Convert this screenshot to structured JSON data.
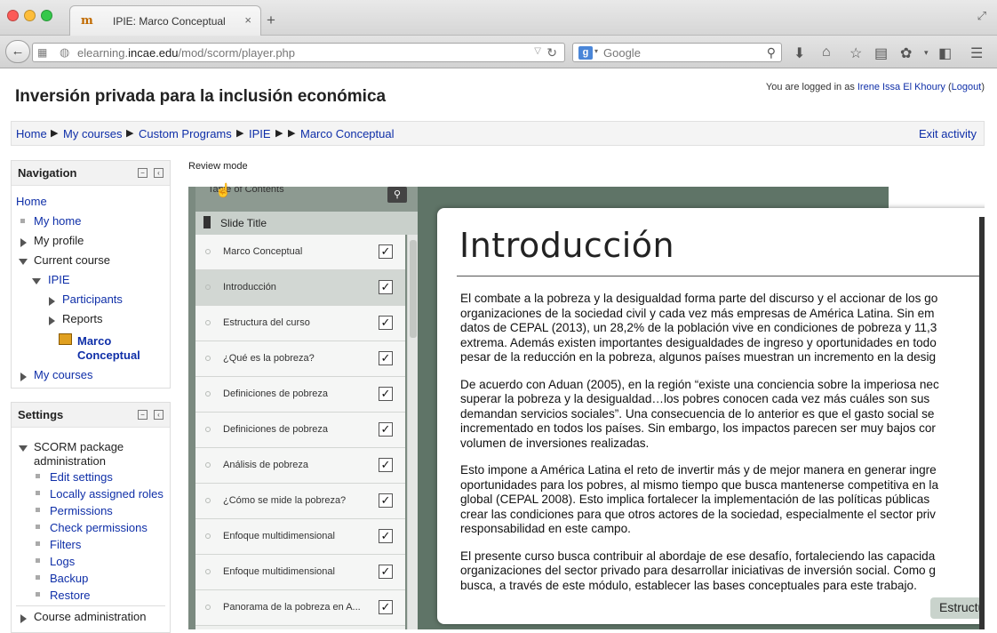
{
  "browser": {
    "tab_title": "IPIE: Marco Conceptual",
    "tab_close": "×",
    "new_tab": "+",
    "url_domain_prefix": "elearning.",
    "url_domain": "incae.edu",
    "url_path": "/mod/scorm/player.php",
    "search_placeholder": "Google"
  },
  "site": {
    "title": "Inversión privada para la inclusión económica",
    "login_prefix": "You are logged in as ",
    "user_name": "Irene Issa El Khoury",
    "logout": "Logout"
  },
  "breadcrumb": {
    "items": [
      "Home",
      "My courses",
      "Custom Programs",
      "IPIE",
      "Marco Conceptual"
    ],
    "exit": "Exit activity"
  },
  "navigation": {
    "title": "Navigation",
    "home": "Home",
    "my_home": "My home",
    "my_profile": "My profile",
    "current_course": "Current course",
    "course": "IPIE",
    "participants": "Participants",
    "reports": "Reports",
    "activity_line1": "Marco",
    "activity_line2": "Conceptual",
    "my_courses": "My courses"
  },
  "settings": {
    "title": "Settings",
    "scorm_line1": "SCORM package",
    "scorm_line2": "administration",
    "items": [
      "Edit settings",
      "Locally assigned roles",
      "Permissions",
      "Check permissions",
      "Filters",
      "Logs",
      "Backup",
      "Restore"
    ],
    "course_admin": "Course administration"
  },
  "review_mode": "Review mode",
  "player": {
    "toc_header": "Table of Contents",
    "slide_title_header": "Slide Title",
    "toc_items": [
      {
        "label": "Marco Conceptual",
        "checked": "✓"
      },
      {
        "label": "Introducción",
        "checked": "✓"
      },
      {
        "label": "Estructura del curso",
        "checked": "✓"
      },
      {
        "label": "¿Qué es la pobreza?",
        "checked": "✓"
      },
      {
        "label": "Definiciones de pobreza",
        "checked": "✓"
      },
      {
        "label": "Definiciones de pobreza",
        "checked": "✓"
      },
      {
        "label": "Análisis de pobreza",
        "checked": "✓"
      },
      {
        "label": "¿Cómo se mide la pobreza?",
        "checked": "✓"
      },
      {
        "label": "Enfoque multidimensional",
        "checked": "✓"
      },
      {
        "label": "Enfoque multidimensional",
        "checked": "✓"
      },
      {
        "label": "Panorama de la pobreza en A...",
        "checked": "✓"
      }
    ],
    "active_index": 1,
    "slide_heading": "Introducción",
    "paragraphs": [
      [
        "El combate a la pobreza y la desigualdad forma parte del discurso y el accionar de los go",
        "organizaciones de la sociedad civil y cada vez más empresas de América Latina. Sin em",
        "datos de CEPAL (2013), un 28,2% de la población vive en condiciones de pobreza y 11,3",
        "extrema. Además existen importantes desigualdades de ingreso y oportunidades en todo",
        "pesar de la reducción en la pobreza, algunos países muestran un incremento en la desig"
      ],
      [
        "De acuerdo con Aduan (2005), en la región “existe una conciencia sobre la imperiosa nec",
        "superar la pobreza y la desigualdad…los pobres conocen cada vez más cuáles son sus",
        "demandan servicios sociales”. Una consecuencia de lo anterior es que el gasto social se",
        "incrementado en todos los países. Sin embargo, los impactos parecen ser muy bajos cor",
        "volumen de inversiones realizadas."
      ],
      [
        "Esto impone a América Latina el reto de invertir más y de mejor manera en generar ingre",
        "oportunidades para los pobres, al mismo tiempo que busca mantenerse competitiva en la",
        "global (CEPAL 2008).  Esto implica fortalecer la implementación de las políticas públicas",
        "crear las condiciones para que otros actores de la sociedad, especialmente el sector priv",
        "responsabilidad en este campo."
      ],
      [
        "El presente curso busca contribuir al abordaje de ese desafío, fortaleciendo las capacida",
        "organizaciones del sector privado para desarrollar iniciativas de inversión social.  Como g",
        "busca, a través de este módulo, establecer las bases conceptuales para este trabajo."
      ]
    ],
    "next_button": "Estructu"
  }
}
